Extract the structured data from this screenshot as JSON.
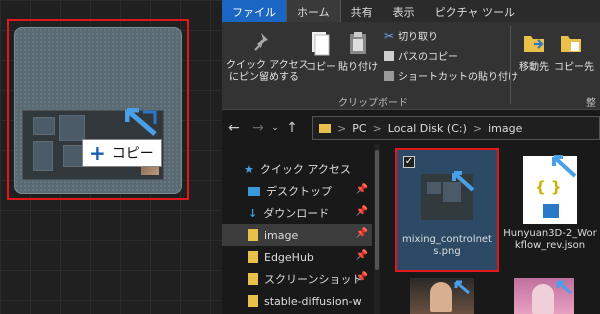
{
  "canvas": {
    "copy_badge_label": "コピー",
    "copy_badge_plus": "+"
  },
  "ribbon": {
    "tabs": [
      {
        "label": "ファイル"
      },
      {
        "label": "ホーム"
      },
      {
        "label": "共有"
      },
      {
        "label": "表示"
      },
      {
        "label": "ピクチャ ツール"
      }
    ],
    "quick_access_line1": "クイック アクセス",
    "quick_access_line2": "にピン留めする",
    "copy": "コピー",
    "paste": "貼り付け",
    "cut": "切り取り",
    "copy_path": "パスのコピー",
    "paste_shortcut": "ショートカットの貼り付け",
    "clipboard_group": "クリップボード",
    "move_to": "移動先",
    "copy_to": "コピー先",
    "organize_group_partial": "整"
  },
  "address": {
    "back": "←",
    "forward": "→",
    "up": "↑",
    "crumbs": [
      "PC",
      "Local Disk (C:)",
      "image"
    ],
    "sep": ">"
  },
  "sidebar": {
    "items": [
      {
        "label": "クイック アクセス",
        "icon": "star-icon"
      },
      {
        "label": "デスクトップ",
        "icon": "desktop-icon"
      },
      {
        "label": "ダウンロード",
        "icon": "download-icon"
      },
      {
        "label": "image",
        "icon": "folder-icon"
      },
      {
        "label": "EdgeHub",
        "icon": "folder-icon"
      },
      {
        "label": "スクリーンショット",
        "icon": "folder-icon"
      },
      {
        "label": "stable-diffusion-w",
        "icon": "folder-icon"
      }
    ]
  },
  "files": [
    {
      "name": "mixing_controlnets.png",
      "checked": "✓"
    },
    {
      "name": "Hunyuan3D-2_Workflow_rev.json",
      "thumb_text": "{ }"
    }
  ],
  "colors": {
    "accent": "#1a66c2",
    "highlight": "#e0181b"
  }
}
